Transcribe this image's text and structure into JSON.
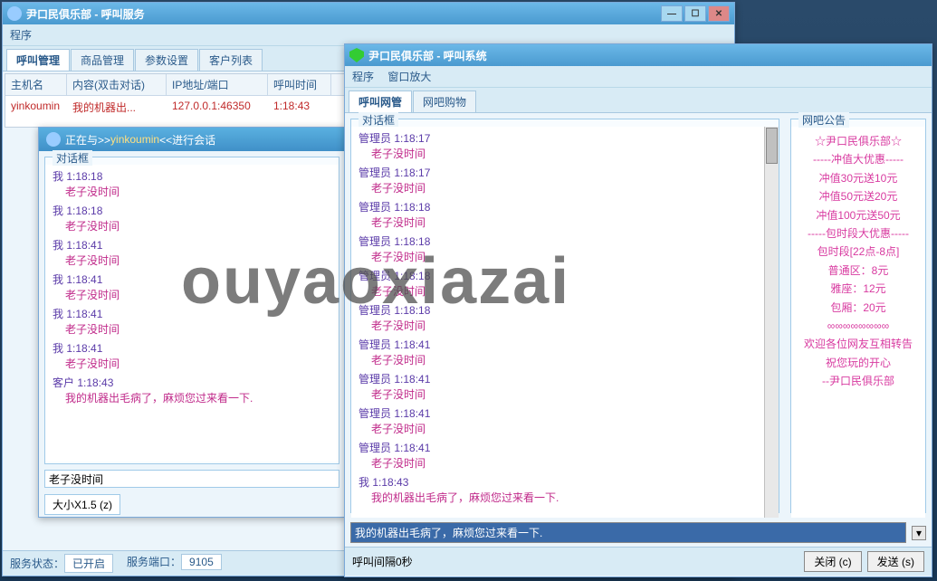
{
  "watermark": "ouyaoxiazai",
  "window1": {
    "title": "尹口民俱乐部 - 呼叫服务",
    "menu": [
      "程序"
    ],
    "tabs": [
      "呼叫管理",
      "商品管理",
      "参数设置",
      "客户列表"
    ],
    "table": {
      "headers": [
        "主机名",
        "内容(双击对话)",
        "IP地址/端口",
        "呼叫时间"
      ],
      "row": {
        "host": "yinkoumin",
        "content": "我的机器出...",
        "ip": "127.0.0.1:46350",
        "time": "1:18:43"
      }
    },
    "status": {
      "state_label": "服务状态：",
      "state_value": "已开启",
      "port_label": "服务端口：",
      "port_value": "9105"
    }
  },
  "chatwin": {
    "title_prefix": "正在与>> ",
    "title_user": "yinkoumin",
    "title_suffix": "<<进行会话",
    "group_label": "对话框",
    "messages": [
      {
        "who": "我",
        "time": "1:18:18",
        "body": "老子没时间"
      },
      {
        "who": "我",
        "time": "1:18:18",
        "body": "老子没时间"
      },
      {
        "who": "我",
        "time": "1:18:41",
        "body": "老子没时间"
      },
      {
        "who": "我",
        "time": "1:18:41",
        "body": "老子没时间"
      },
      {
        "who": "我",
        "time": "1:18:41",
        "body": "老子没时间"
      },
      {
        "who": "我",
        "time": "1:18:41",
        "body": "老子没时间"
      },
      {
        "who": "客户",
        "time": "1:18:43",
        "body": "我的机器出毛病了，麻烦您过来看一下."
      }
    ],
    "input_value": "老子没时间",
    "size_btn": "大小X1.5 (z)"
  },
  "window2": {
    "title": "尹口民俱乐部  - 呼叫系统",
    "menu": [
      "程序",
      "窗口放大"
    ],
    "tabs": [
      "呼叫网管",
      "网吧购物"
    ],
    "dialog_label": "对话框",
    "announce_label": "网吧公告",
    "messages": [
      {
        "who": "管理员",
        "time": "1:18:17",
        "body": "老子没时间"
      },
      {
        "who": "管理员",
        "time": "1:18:17",
        "body": "老子没时间"
      },
      {
        "who": "管理员",
        "time": "1:18:18",
        "body": "老子没时间"
      },
      {
        "who": "管理员",
        "time": "1:18:18",
        "body": "老子没时间"
      },
      {
        "who": "管理员",
        "time": "1:18:18",
        "body": "老子没时间"
      },
      {
        "who": "管理员",
        "time": "1:18:18",
        "body": "老子没时间"
      },
      {
        "who": "管理员",
        "time": "1:18:41",
        "body": "老子没时间"
      },
      {
        "who": "管理员",
        "time": "1:18:41",
        "body": "老子没时间"
      },
      {
        "who": "管理员",
        "time": "1:18:41",
        "body": "老子没时间"
      },
      {
        "who": "管理员",
        "time": "1:18:41",
        "body": "老子没时间"
      },
      {
        "who": "我",
        "time": "1:18:43",
        "body": "我的机器出毛病了，麻烦您过来看一下."
      }
    ],
    "announcement": [
      "☆尹口民俱乐部☆",
      "-----冲值大优惠-----",
      "冲值30元送10元",
      "冲值50元送20元",
      "冲值100元送50元",
      "-----包时段大优惠-----",
      "包时段[22点-8点]",
      "普通区：8元",
      "雅座：12元",
      "包厢：20元",
      "∞∞∞∞∞∞∞∞",
      "欢迎各位网友互相转告",
      "祝您玩的开心",
      "--尹口民俱乐部"
    ],
    "dropdown_value": "我的机器出毛病了，麻烦您过来看一下.",
    "interval_label": "呼叫间隔0秒",
    "close_btn": "关闭 (c)",
    "send_btn": "发送 (s)"
  }
}
